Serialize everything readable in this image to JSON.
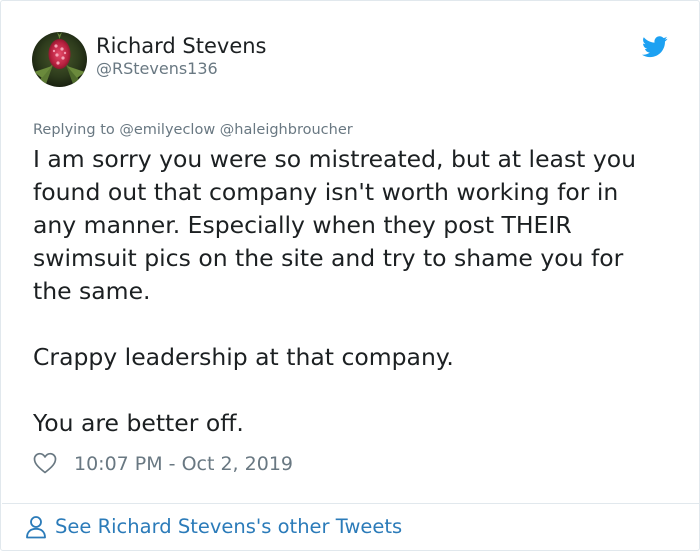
{
  "author": {
    "display_name": "Richard Stevens",
    "handle": "@RStevens136",
    "avatar_icon": "avatar-photo"
  },
  "brand_icon": "twitter-bird-icon",
  "colors": {
    "brand": "#1da1f2",
    "link": "#2b7bb9",
    "secondary_text": "#697882",
    "primary_text": "#1c2022",
    "border": "#e1e8ed"
  },
  "reply_to": "Replying to @emilyeclow @haleighbroucher",
  "tweet_text": "I am sorry you were so mistreated, but at least you\nfound out that company isn't worth working for in\nany manner. Especially when they post THEIR\nswimsuit pics on the site and try to shame you for\nthe same.\n\nCrappy leadership at that company.\n\nYou are better off.",
  "meta": {
    "like_icon": "heart-icon",
    "timestamp": "10:07 PM - Oct 2, 2019"
  },
  "footer": {
    "icon": "person-icon",
    "link_text": "See Richard Stevens's other Tweets"
  }
}
